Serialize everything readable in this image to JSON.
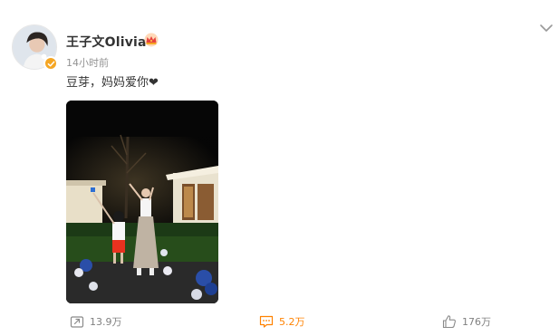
{
  "post": {
    "author": "王子文Olivia",
    "time": "14小时前",
    "text": "豆芽，妈妈爱你❤",
    "icons": {
      "avatar": "avatar-image",
      "verified": "verified-badge-icon",
      "crown": "crown-badge-icon",
      "more": "chevron-down-icon",
      "photo": "night-garden-photo"
    }
  },
  "actions": {
    "repost": {
      "icon": "repost-icon",
      "count": "13.9万"
    },
    "comment": {
      "icon": "comment-icon",
      "count": "5.2万",
      "color": "#ff8200"
    },
    "like": {
      "icon": "thumbs-up-icon",
      "count": "176万"
    }
  },
  "colors": {
    "accent": "#ff8200",
    "badge": "#f5a623",
    "muted": "#939393"
  }
}
